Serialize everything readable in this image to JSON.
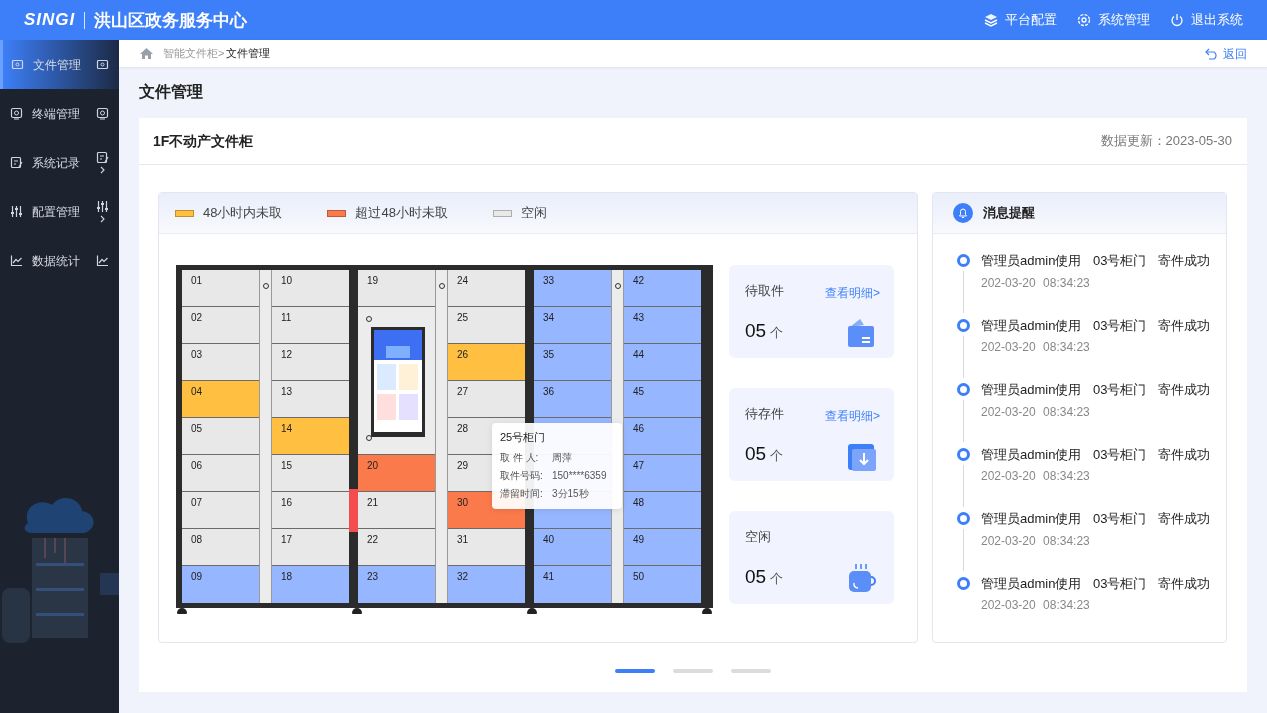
{
  "header": {
    "logo": "SINGI",
    "title": "洪山区政务服务中心",
    "actions": [
      {
        "label": "平台配置"
      },
      {
        "label": "系统管理"
      },
      {
        "label": "退出系统"
      }
    ]
  },
  "sidebar": {
    "items": [
      {
        "label": "文件管理",
        "selected": true,
        "has_submenu": false
      },
      {
        "label": "终端管理",
        "selected": false,
        "has_submenu": false
      },
      {
        "label": "系统记录",
        "selected": false,
        "has_submenu": true
      },
      {
        "label": "配置管理",
        "selected": false,
        "has_submenu": true
      },
      {
        "label": "数据统计",
        "selected": false,
        "has_submenu": false
      }
    ]
  },
  "breadcrumb": {
    "parent": "智能文件柜>",
    "current": "文件管理",
    "back": "返回"
  },
  "page_title": "文件管理",
  "card": {
    "title": "1F不动产文件柜",
    "updated": "数据更新：2023-05-30"
  },
  "legend": [
    {
      "label": "48小时内未取",
      "color": "#ffbf40"
    },
    {
      "label": "超过48小时未取",
      "color": "#fb7a4c"
    },
    {
      "label": "空闲",
      "color": "#e8e8e8"
    }
  ],
  "locker": {
    "units": [
      {
        "columns": [
          [
            {
              "number": "01",
              "color": "#e8e8e8"
            },
            {
              "number": "02",
              "color": "#e8e8e8"
            },
            {
              "number": "03",
              "color": "#e8e8e8"
            },
            {
              "number": "04",
              "color": "#ffbf40"
            },
            {
              "number": "05",
              "color": "#e8e8e8"
            },
            {
              "number": "06",
              "color": "#e8e8e8"
            },
            {
              "number": "07",
              "color": "#e8e8e8"
            },
            {
              "number": "08",
              "color": "#e8e8e8"
            },
            {
              "number": "09",
              "color": "#96b6ff"
            }
          ],
          [
            {
              "number": "10",
              "color": "#e8e8e8"
            },
            {
              "number": "11",
              "color": "#e8e8e8"
            },
            {
              "number": "12",
              "color": "#e8e8e8"
            },
            {
              "number": "13",
              "color": "#e8e8e8"
            },
            {
              "number": "14",
              "color": "#ffbf40"
            },
            {
              "number": "15",
              "color": "#e8e8e8"
            },
            {
              "number": "16",
              "color": "#e8e8e8"
            },
            {
              "number": "17",
              "color": "#e8e8e8"
            },
            {
              "number": "18",
              "color": "#96b6ff"
            }
          ]
        ]
      },
      {
        "columns": [
          [
            {
              "number": "19",
              "color": "#e8e8e8"
            },
            {
              "kind": "screen"
            },
            {
              "number": "20",
              "color": "#fb7a4c"
            },
            {
              "number": "21",
              "color": "#e8e8e8"
            },
            {
              "number": "22",
              "color": "#e8e8e8"
            },
            {
              "number": "23",
              "color": "#96b6ff"
            }
          ],
          [
            {
              "number": "24",
              "color": "#e8e8e8"
            },
            {
              "number": "25",
              "color": "#e8e8e8"
            },
            {
              "number": "26",
              "color": "#ffbf40"
            },
            {
              "number": "27",
              "color": "#e8e8e8"
            },
            {
              "number": "28",
              "color": "#e8e8e8"
            },
            {
              "number": "29",
              "color": "#e8e8e8"
            },
            {
              "number": "30",
              "color": "#fb7a4c"
            },
            {
              "number": "31",
              "color": "#e8e8e8"
            },
            {
              "number": "32",
              "color": "#96b6ff"
            }
          ]
        ]
      },
      {
        "columns": [
          [
            {
              "number": "33",
              "color": "#96b6ff"
            },
            {
              "number": "34",
              "color": "#96b6ff"
            },
            {
              "number": "35",
              "color": "#96b6ff"
            },
            {
              "number": "36",
              "color": "#96b6ff"
            },
            {
              "color": "#96b6ff"
            },
            {
              "kind": "covered"
            },
            {
              "color": "#96b6ff"
            },
            {
              "number": "40",
              "color": "#96b6ff"
            },
            {
              "number": "41",
              "color": "#96b6ff"
            }
          ],
          [
            {
              "number": "42",
              "color": "#96b6ff"
            },
            {
              "number": "43",
              "color": "#96b6ff"
            },
            {
              "number": "44",
              "color": "#96b6ff"
            },
            {
              "number": "45",
              "color": "#96b6ff"
            },
            {
              "number": "46",
              "color": "#96b6ff"
            },
            {
              "number": "47",
              "color": "#96b6ff"
            },
            {
              "number": "48",
              "color": "#96b6ff"
            },
            {
              "number": "49",
              "color": "#96b6ff"
            },
            {
              "number": "50",
              "color": "#96b6ff"
            }
          ]
        ]
      }
    ],
    "tooltip": {
      "title": "25号柜门",
      "rows": [
        {
          "label": "取 件 人:",
          "value": "周萍"
        },
        {
          "label": "取件号码:",
          "value": "150****6359"
        },
        {
          "label": "滞留时间:",
          "value": "3分15秒"
        }
      ]
    }
  },
  "stats": [
    {
      "label": "待取件",
      "link": "查看明细>",
      "count": "05",
      "unit": "个"
    },
    {
      "label": "待存件",
      "link": "查看明细>",
      "count": "05",
      "unit": "个"
    },
    {
      "label": "空闲",
      "count": "05",
      "unit": "个"
    }
  ],
  "messages": {
    "title": "消息提醒",
    "items": [
      {
        "text": "管理员admin使用 03号柜门 寄件成功",
        "time": "202-03-20 08:34:23"
      },
      {
        "text": "管理员admin使用 03号柜门 寄件成功",
        "time": "202-03-20 08:34:23"
      },
      {
        "text": "管理员admin使用 03号柜门 寄件成功",
        "time": "202-03-20 08:34:23"
      },
      {
        "text": "管理员admin使用 03号柜门 寄件成功",
        "time": "202-03-20 08:34:23"
      },
      {
        "text": "管理员admin使用 03号柜门 寄件成功",
        "time": "202-03-20 08:34:23"
      },
      {
        "text": "管理员admin使用 03号柜门 寄件成功",
        "time": "202-03-20 08:34:23"
      }
    ]
  },
  "pagination": [
    {
      "selected": true
    },
    {
      "selected": false
    },
    {
      "selected": false
    }
  ]
}
